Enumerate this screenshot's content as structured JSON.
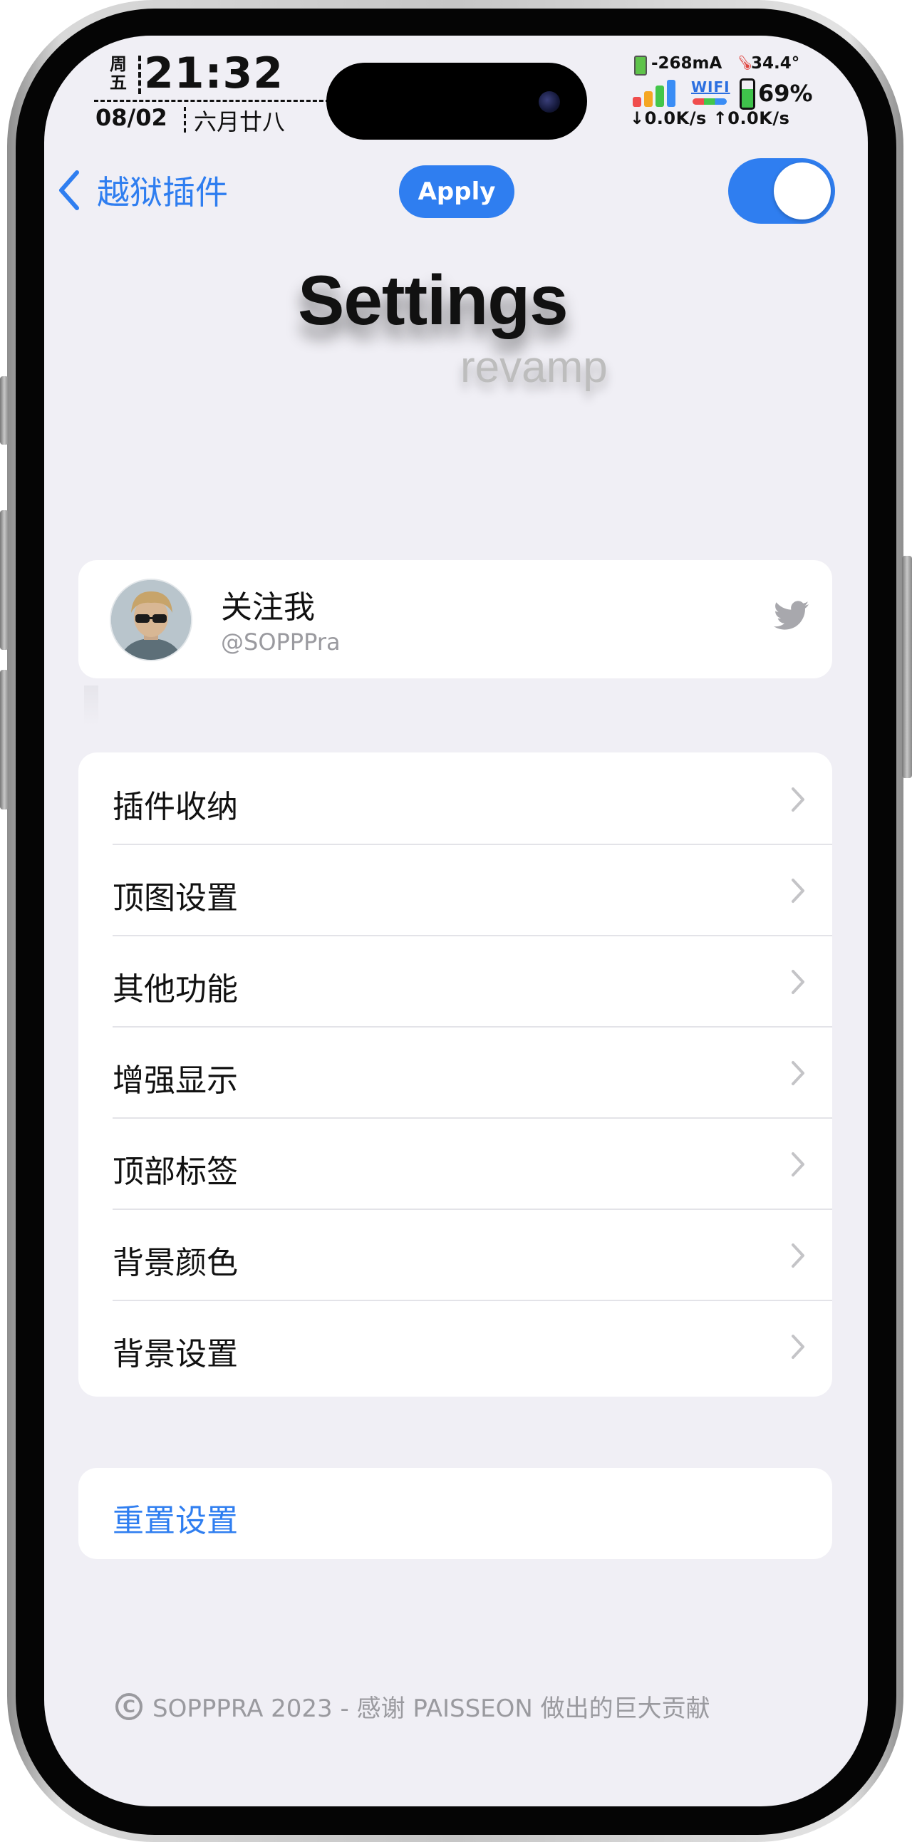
{
  "status_bar": {
    "weekday": "周五",
    "time": "21:32",
    "date": "08/02",
    "lunar_date": "六月廿八",
    "current": "-268mA",
    "temperature": "34.4°",
    "wifi_label": "WIFI",
    "battery_percent": "69%",
    "battery_level": 0.69,
    "net_speed": "↓0.0K/s ↑0.0K/s"
  },
  "nav": {
    "back_label": "越狱插件",
    "apply_label": "Apply",
    "toggle_on": true,
    "accent_color": "#2f7ef0"
  },
  "header": {
    "title": "Settings",
    "subtitle": "revamp"
  },
  "profile": {
    "name": "关注我",
    "handle": "@SOPPPra",
    "icon": "twitter-bird-icon"
  },
  "menu": {
    "items": [
      {
        "label": "插件收纳"
      },
      {
        "label": "顶图设置"
      },
      {
        "label": "其他功能"
      },
      {
        "label": "增强显示"
      },
      {
        "label": "顶部标签"
      },
      {
        "label": "背景颜色"
      },
      {
        "label": "背景设置"
      }
    ]
  },
  "reset": {
    "label": "重置设置"
  },
  "footer": {
    "text": "SOPPPRA 2023 - 感谢 PAISSEON 做出的巨大贡献"
  }
}
